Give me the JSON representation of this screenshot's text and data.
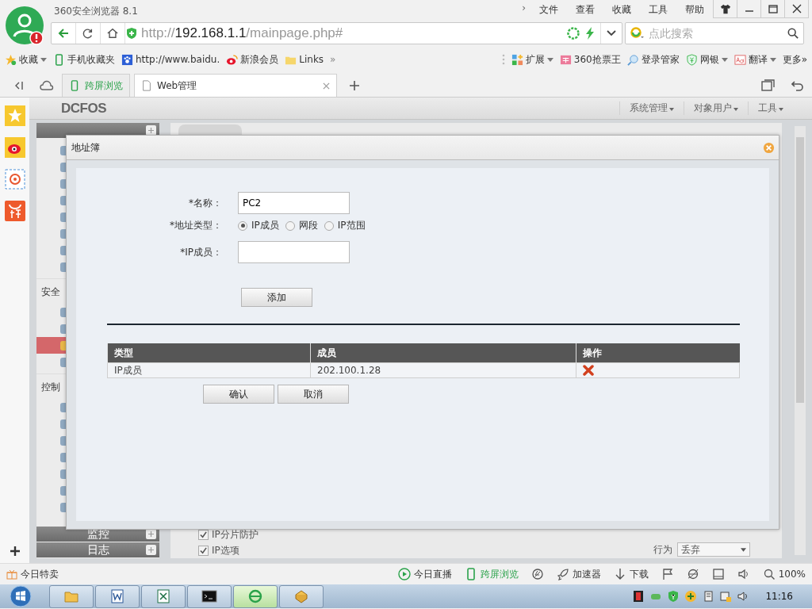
{
  "browser": {
    "title": "360安全浏览器 8.1",
    "menu_more": "›",
    "menu": [
      "文件",
      "查看",
      "收藏",
      "工具",
      "帮助"
    ],
    "address": {
      "scheme": "http://",
      "host": "192.168.1.1",
      "path": "/mainpage.php#"
    },
    "search": {
      "placeholder": "点此搜索"
    },
    "bookmarks": [
      {
        "kind": "star",
        "label": "收藏",
        "dropdown": true
      },
      {
        "kind": "phone",
        "label": "手机收藏夹",
        "dropdown": false
      },
      {
        "kind": "paw",
        "label": "http://www.baidu.",
        "dropdown": false
      },
      {
        "kind": "weibo",
        "label": "新浪会员",
        "dropdown": false
      },
      {
        "kind": "folder",
        "label": "Links",
        "dropdown": false
      }
    ],
    "bookmarks_more": "»",
    "extensions": [
      {
        "kind": "grid",
        "label": "扩展",
        "dropdown": true
      },
      {
        "kind": "ticket",
        "label": "360抢票王",
        "dropdown": false
      },
      {
        "kind": "key",
        "label": "登录管家",
        "dropdown": false
      },
      {
        "kind": "shield",
        "label": "网银",
        "dropdown": true
      },
      {
        "kind": "translate",
        "label": "翻译",
        "dropdown": true
      }
    ],
    "extensions_more": "更多»",
    "tabs": [
      {
        "kind": "phone",
        "label": "跨屏浏览",
        "selected": false
      },
      {
        "kind": "page",
        "label": "Web管理",
        "selected": true
      }
    ]
  },
  "page": {
    "logo": "DCFOS",
    "nav": [
      "系统管理",
      "对象用户",
      "工具"
    ],
    "sidebar": {
      "top_items": [
        {
          "selected": false
        },
        {
          "selected": false
        },
        {
          "selected": false
        },
        {
          "selected": false
        },
        {
          "selected": false
        },
        {
          "selected": false
        },
        {
          "selected": false
        },
        {
          "selected": false
        }
      ],
      "sections": [
        {
          "label": "安全",
          "items": [
            {
              "selected": false
            },
            {
              "selected": false
            },
            {
              "selected": true
            },
            {
              "selected": false
            }
          ]
        },
        {
          "label": "控制",
          "items": [
            {
              "selected": false
            },
            {
              "selected": false
            },
            {
              "selected": false
            },
            {
              "selected": false
            },
            {
              "selected": false
            },
            {
              "selected": false
            },
            {
              "selected": false
            }
          ]
        }
      ],
      "footer": [
        "监控",
        "日志"
      ]
    },
    "options": [
      {
        "label": "IP分片防护",
        "checked": true
      },
      {
        "label": "IP选项",
        "checked": true
      }
    ],
    "action": {
      "label": "行为",
      "value": "丢弃"
    }
  },
  "dialog": {
    "title": "地址簿",
    "name": {
      "label": "*名称：",
      "value": "PC2"
    },
    "address_type": {
      "label": "*地址类型：",
      "options": [
        {
          "label": "IP成员",
          "selected": true
        },
        {
          "label": "网段",
          "selected": false
        },
        {
          "label": "IP范围",
          "selected": false
        }
      ]
    },
    "member": {
      "label": "*IP成员："
    },
    "add_button": "添加",
    "table": {
      "columns": [
        "类型",
        "成员",
        "操作"
      ],
      "rows": [
        {
          "type": "IP成员",
          "member": "202.100.1.28"
        }
      ]
    },
    "buttons": [
      "确认",
      "取消"
    ]
  },
  "status_bar": {
    "left": "今日特卖",
    "items": [
      {
        "kind": "play",
        "label": "今日直播"
      },
      {
        "kind": "phone",
        "label": "跨屏浏览"
      },
      {
        "kind": "swirl"
      },
      {
        "kind": "rocket",
        "label": "加速器"
      },
      {
        "kind": "download",
        "label": "下载"
      },
      {
        "kind": "flag"
      },
      {
        "kind": "ie"
      },
      {
        "kind": "window"
      },
      {
        "kind": "speaker"
      },
      {
        "kind": "zoom",
        "label": "100%"
      }
    ]
  },
  "taskbar": {
    "apps": [
      {
        "kind": "explorer",
        "selected": false
      },
      {
        "kind": "word",
        "selected": false
      },
      {
        "kind": "excel",
        "selected": false
      },
      {
        "kind": "cmd",
        "selected": false
      },
      {
        "kind": "ie",
        "selected": true
      },
      {
        "kind": "app",
        "selected": false
      }
    ],
    "time": "11:16"
  }
}
